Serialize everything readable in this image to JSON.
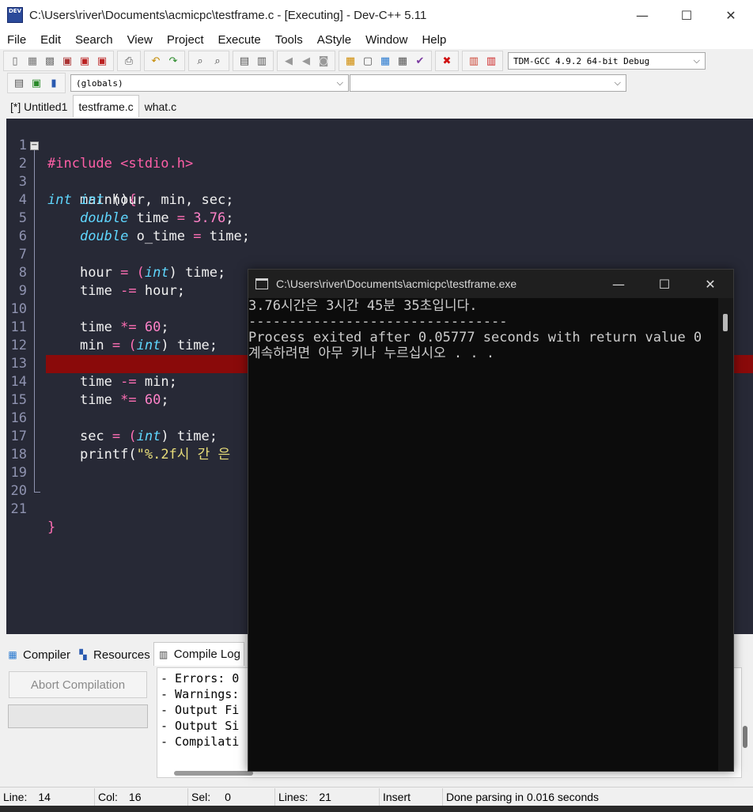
{
  "window": {
    "title": "C:\\Users\\river\\Documents\\acmicpc\\testframe.c - [Executing] - Dev-C++ 5.11",
    "icon_label": "DEV",
    "minimize": "—",
    "maximize": "☐",
    "close": "✕"
  },
  "menu": [
    "File",
    "Edit",
    "Search",
    "View",
    "Project",
    "Execute",
    "Tools",
    "AStyle",
    "Window",
    "Help"
  ],
  "toolbar": {
    "compiler_select": "TDM-GCC 4.9.2 64-bit Debug",
    "scope_select": "(globals)",
    "member_select": ""
  },
  "editor_tabs": [
    {
      "label": "[*] Untitled1",
      "active": false
    },
    {
      "label": "testframe.c",
      "active": true
    },
    {
      "label": "what.c",
      "active": false
    }
  ],
  "code": {
    "highlight_line": 14,
    "lines": [
      {
        "n": "1"
      },
      {
        "n": "2"
      },
      {
        "n": "3"
      },
      {
        "n": "4"
      },
      {
        "n": "5"
      },
      {
        "n": "6"
      },
      {
        "n": "7"
      },
      {
        "n": "8"
      },
      {
        "n": "9"
      },
      {
        "n": "10"
      },
      {
        "n": "11"
      },
      {
        "n": "12"
      },
      {
        "n": "13"
      },
      {
        "n": "14"
      },
      {
        "n": "15"
      },
      {
        "n": "16"
      },
      {
        "n": "17"
      },
      {
        "n": "18"
      },
      {
        "n": "19"
      },
      {
        "n": "20"
      },
      {
        "n": "21"
      }
    ],
    "tokens": {
      "l1": [
        "#include <stdio.h>"
      ],
      "l2": [
        "int",
        " main()",
        "{"
      ],
      "l3": [
        "int",
        " hour, min, sec;"
      ],
      "l4": [
        "double",
        " time ",
        "=",
        " ",
        "3.76",
        ";"
      ],
      "l5": [
        "double",
        " o_time ",
        "=",
        " time;"
      ],
      "l7": [
        "hour ",
        "=",
        " (",
        "int",
        ") time;"
      ],
      "l8": [
        "time ",
        "-=",
        " hour;"
      ],
      "l10": [
        "time ",
        "*=",
        " ",
        "60",
        ";"
      ],
      "l11": [
        "min ",
        "=",
        " (",
        "int",
        ") time;"
      ],
      "l13": [
        "time ",
        "-=",
        " min;"
      ],
      "l14": [
        "time ",
        "*=",
        " ",
        "60",
        ";"
      ],
      "l16": [
        "sec ",
        "=",
        " (",
        "int",
        ") time;"
      ],
      "l17": [
        "printf(",
        "\"%.2f시 간 은  "
      ],
      "l21": [
        "}"
      ]
    }
  },
  "bottom_tabs": [
    {
      "label": "Compiler",
      "icon": "grid-icon"
    },
    {
      "label": "Resources",
      "icon": "resources-icon"
    },
    {
      "label": "Compile Log",
      "icon": "chart-icon",
      "active": true
    }
  ],
  "abort_button": "Abort Compilation",
  "compile_log": [
    "- Errors: 0",
    "- Warnings:",
    "- Output Fi",
    "- Output Si",
    "- Compilati"
  ],
  "status": {
    "line_label": "Line:",
    "line_value": "14",
    "col_label": "Col:",
    "col_value": "16",
    "sel_label": "Sel:",
    "sel_value": "0",
    "lines_label": "Lines:",
    "lines_value": "21",
    "mode": "Insert",
    "message": "Done parsing in 0.016 seconds"
  },
  "console": {
    "title": "C:\\Users\\river\\Documents\\acmicpc\\testframe.exe",
    "minimize": "—",
    "maximize": "☐",
    "close": "✕",
    "output": "3.76시간은 3시간 45분 35초입니다.\n--------------------------------\nProcess exited after 0.05777 seconds with return value 0\n계속하려면 아무 키나 누르십시오 . . ."
  }
}
